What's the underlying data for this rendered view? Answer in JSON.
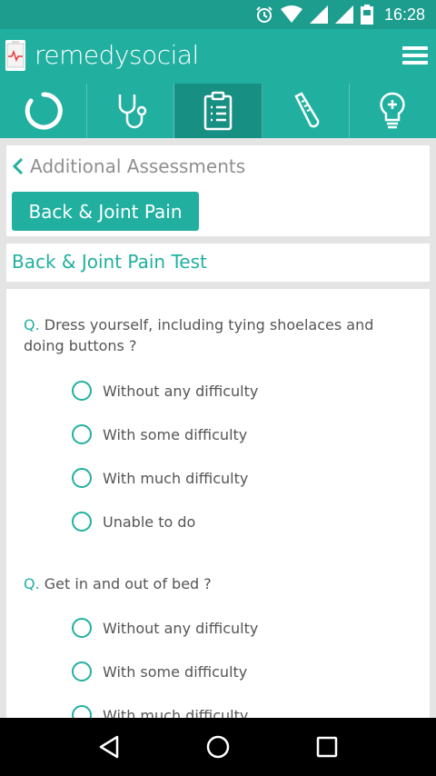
{
  "status_bar": {
    "time": "16:28",
    "icons": [
      "alarm-icon",
      "wifi-icon",
      "signal-icon",
      "signal-icon",
      "battery-icon"
    ]
  },
  "app": {
    "brand": "remedysocial"
  },
  "tabs": [
    {
      "icon": "loading-circle-icon"
    },
    {
      "icon": "stethoscope-icon"
    },
    {
      "icon": "clipboard-icon",
      "active": true
    },
    {
      "icon": "thermometer-icon"
    },
    {
      "icon": "lightbulb-icon"
    }
  ],
  "breadcrumb": {
    "back_label": "Additional Assessments"
  },
  "category_button": "Back & Joint Pain",
  "test_title": "Back & Joint Pain Test",
  "question_prefix": "Q.",
  "questions": [
    {
      "text": "Dress yourself, including tying shoelaces and doing buttons ?",
      "options": [
        "Without any difficulty",
        "With some difficulty",
        "With much difficulty",
        "Unable to do"
      ]
    },
    {
      "text": "Get in and out of bed ?",
      "options": [
        "Without any difficulty",
        "With some difficulty",
        "With much difficulty"
      ]
    }
  ],
  "colors": {
    "accent": "#21b0a0",
    "status_bar": "#1d9d8e",
    "active_tab": "#178f82"
  }
}
